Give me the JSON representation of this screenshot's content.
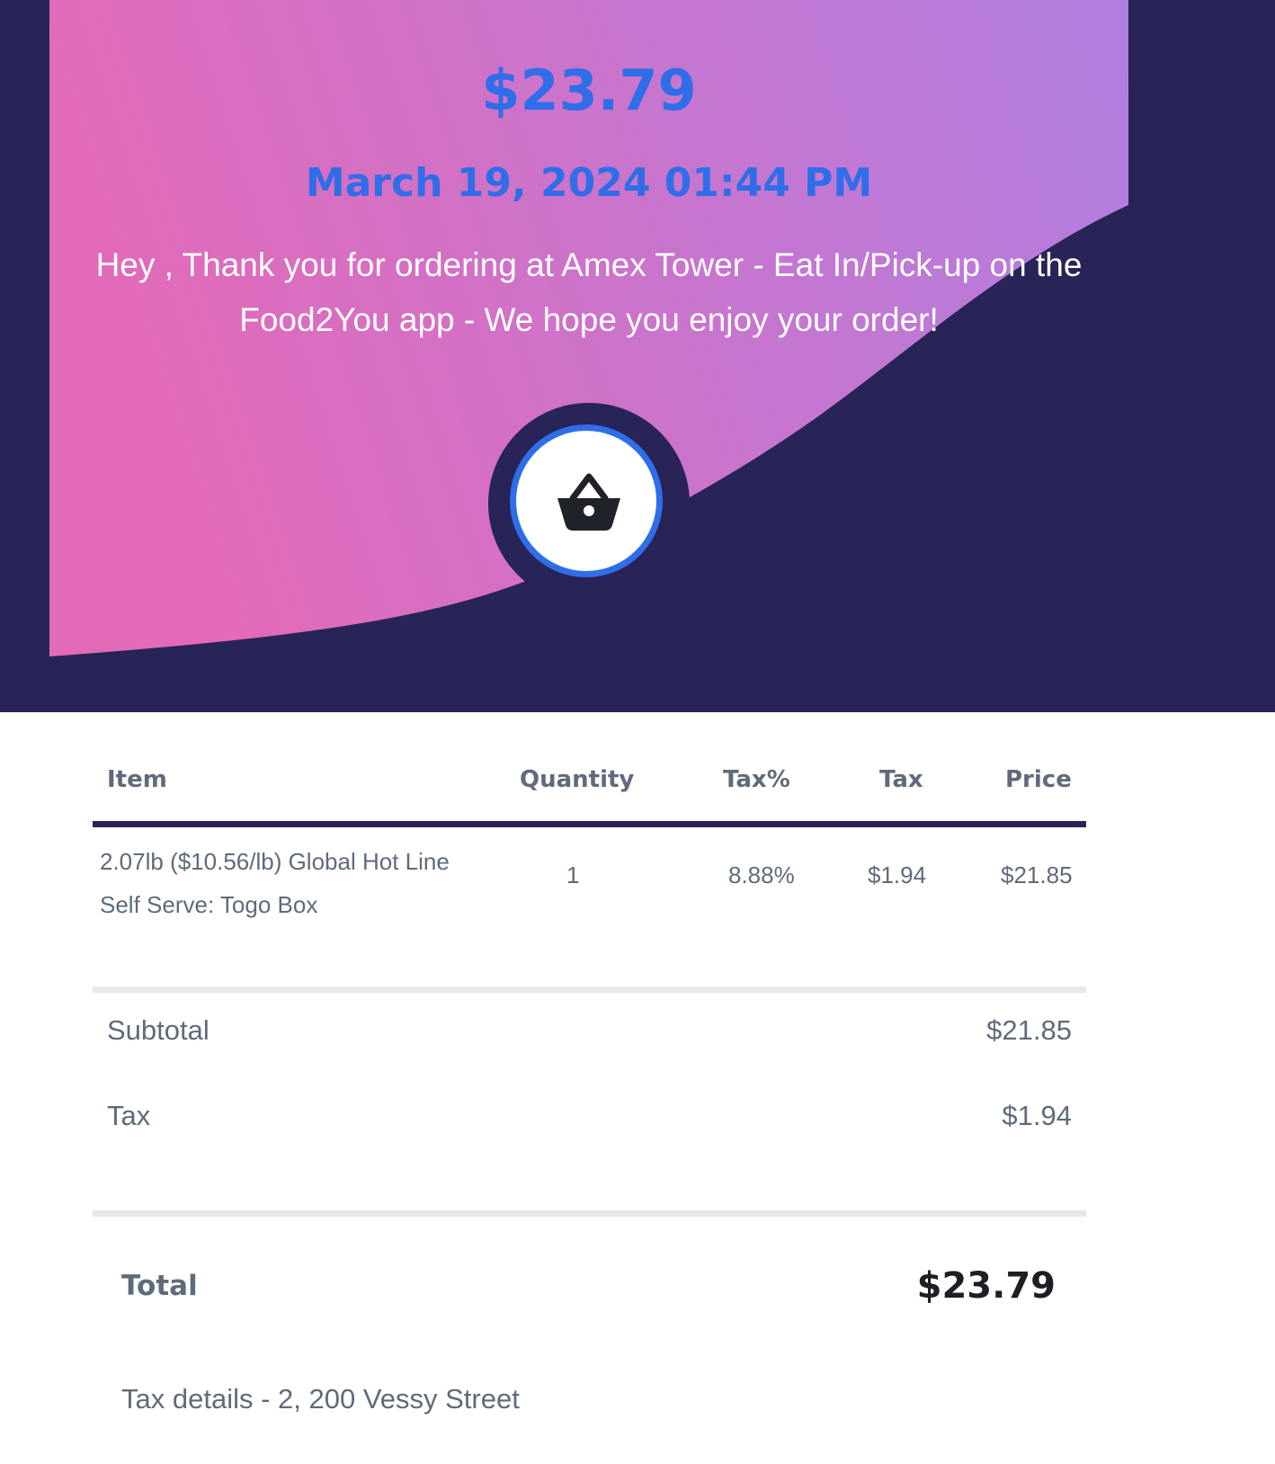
{
  "header": {
    "amount": "$23.79",
    "datetime": "March 19, 2024 01:44 PM",
    "message": "Hey , Thank you for ordering at Amex Tower - Eat In/Pick-up on the Food2You app - We hope you enjoy your order!",
    "badge_icon": "shopping-basket-icon"
  },
  "colors": {
    "navy_background": "#282457",
    "gradient_start": "#e36ab8",
    "gradient_end": "#b07ee0",
    "accent_blue": "#2f6ee8",
    "text_gray": "#5f6b7a"
  },
  "table": {
    "headers": {
      "item": "Item",
      "quantity": "Quantity",
      "tax_percent": "Tax%",
      "tax": "Tax",
      "price": "Price"
    },
    "rows": [
      {
        "item_line1": "2.07lb ($10.56/lb) Global Hot Line",
        "item_line2": "Self Serve: Togo Box",
        "quantity": "1",
        "tax_percent": "8.88%",
        "tax": "$1.94",
        "price": "$21.85"
      }
    ]
  },
  "summary": {
    "subtotal_label": "Subtotal",
    "subtotal_value": "$21.85",
    "tax_label": "Tax",
    "tax_value": "$1.94",
    "total_label": "Total",
    "total_value": "$23.79"
  },
  "footer": {
    "tax_details": "Tax details - 2, 200 Vessy Street"
  }
}
